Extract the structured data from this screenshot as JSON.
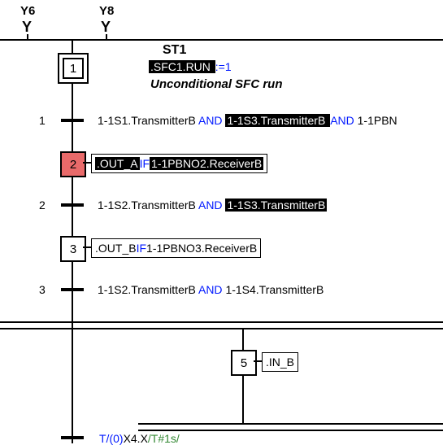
{
  "y_labels": {
    "y6": "Y6",
    "y8": "Y8"
  },
  "heading": {
    "st1": "ST1",
    "sfc_run": ".SFC1.RUN ",
    "assign": ":=1",
    "uncond": "Unconditional SFC run"
  },
  "steps": {
    "s1": {
      "num": "1"
    },
    "s2": {
      "num": "2"
    },
    "s3": {
      "num": "3"
    },
    "s5": {
      "num": "5"
    }
  },
  "transitions": {
    "t1": {
      "label": "1",
      "seg1": "1-1S1.TransmitterB ",
      "op1": "AND ",
      "seg2": "1-1S3.TransmitterB ",
      "op2": "AND ",
      "seg3": "1-1PBN"
    },
    "t2": {
      "label": "2",
      "seg1": "1-1S2.TransmitterB ",
      "op1": "AND ",
      "seg2": "1-1S3.TransmitterB"
    },
    "t3": {
      "label": "3",
      "seg1": "1-1S2.TransmitterB ",
      "op1": "AND ",
      "seg2": "1-1S4.TransmitterB"
    }
  },
  "actions": {
    "a2": {
      "out": ".OUT_A ",
      "if": "IF ",
      "cond": "1-1PBNO2.ReceiverB"
    },
    "a3": {
      "out": ".OUT_B ",
      "if": "IF ",
      "cond": "1-1PBNO3.ReceiverB"
    },
    "a5": {
      "out": ".IN_B"
    }
  },
  "footer": {
    "pre": "T/(0)",
    "mid": "X4.X",
    "post": "/T#1s/"
  }
}
